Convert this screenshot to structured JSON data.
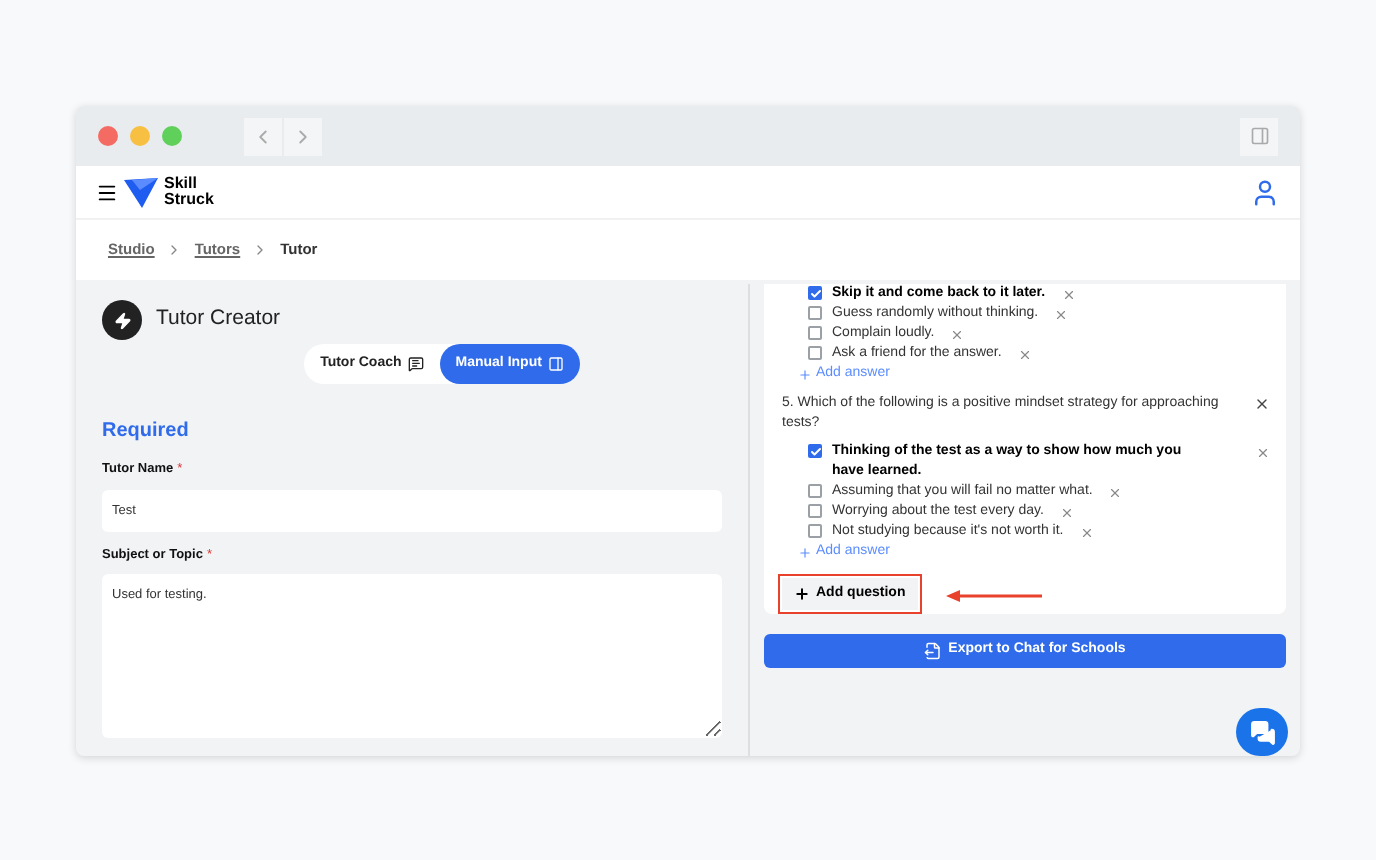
{
  "header": {
    "brand": [
      "Skill",
      "Struck"
    ]
  },
  "breadcrumb": [
    {
      "label": "Studio",
      "kind": "link"
    },
    {
      "label": "Tutors",
      "kind": "link"
    },
    {
      "label": "Tutor",
      "kind": "current"
    }
  ],
  "creator": {
    "title": "Tutor Creator",
    "modes": [
      {
        "label": "Tutor Coach",
        "selected": false
      },
      {
        "label": "Manual Input",
        "selected": true
      }
    ],
    "section_title": "Required",
    "fields": [
      {
        "label": "Tutor Name",
        "required_mark": "*",
        "kind": "input",
        "value": "Test"
      },
      {
        "label": "Subject or Topic",
        "required_mark": "*",
        "kind": "textarea",
        "value": "Used for testing."
      }
    ]
  },
  "quiz": {
    "questions": [
      {
        "answers": [
          {
            "text": "Skip it and come back to it later.",
            "checked": true
          },
          {
            "text": "Guess randomly without thinking.",
            "checked": false
          },
          {
            "text": "Complain loudly.",
            "checked": false
          },
          {
            "text": "Ask a friend for the answer.",
            "checked": false
          }
        ],
        "add_answer": "Add answer"
      },
      {
        "text": "5. Which of the following is a positive mindset strategy for approaching tests?",
        "answers": [
          {
            "text": "Thinking of the test as a way to show how much you have learned.",
            "checked": true
          },
          {
            "text": "Assuming that you will fail no matter what.",
            "checked": false
          },
          {
            "text": "Worrying about the test every day.",
            "checked": false
          },
          {
            "text": "Not studying because it's not worth it.",
            "checked": false
          }
        ],
        "add_answer": "Add answer"
      }
    ],
    "add_question": "Add question",
    "highlighted": true
  },
  "export_button": "Export to Chat for Schools"
}
